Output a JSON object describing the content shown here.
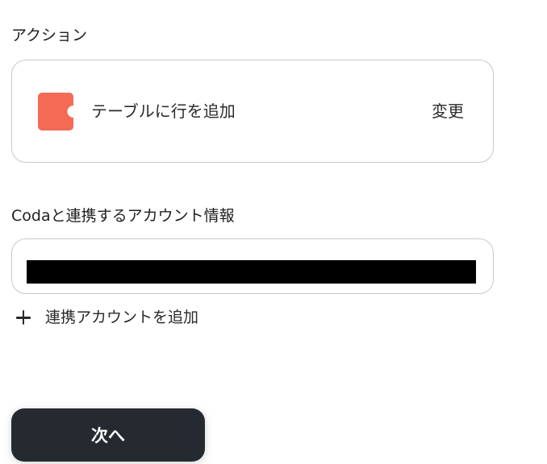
{
  "action_section": {
    "label": "アクション",
    "app_icon": "coda-logo-icon",
    "action_name": "テーブルに行を追加",
    "change_label": "変更"
  },
  "account_section": {
    "label": "Codaと連携するアカウント情報",
    "selected_account": "[redacted]",
    "add_account_label": "連携アカウントを追加"
  },
  "footer": {
    "next_label": "次へ"
  },
  "colors": {
    "coda_brand": "#F46A54",
    "primary_button": "#252A31",
    "border": "#C8C8CC"
  }
}
